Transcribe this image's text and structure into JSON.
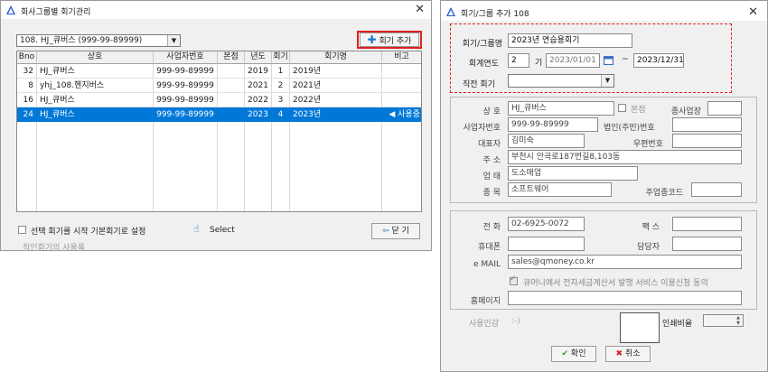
{
  "left_window": {
    "title": "회사그룹별 회기관리",
    "company_select": "108. HJ_큐버스 (999-99-89999)",
    "add_button": "회기 추가",
    "columns": [
      "Bno",
      "상호",
      "사업자번호",
      "본점",
      "년도",
      "회기",
      "회기명",
      "비고"
    ],
    "rows": [
      {
        "bno": "32",
        "name": "HJ_큐버스",
        "bizno": "999-99-89999",
        "hq": "",
        "year": "2019",
        "term": "1",
        "term_name": "2019년",
        "note": ""
      },
      {
        "bno": "8",
        "name": "yhj_108.헨지버스",
        "bizno": "999-99-89999",
        "hq": "",
        "year": "2021",
        "term": "2",
        "term_name": "2021년",
        "note": ""
      },
      {
        "bno": "16",
        "name": "HJ_큐버스",
        "bizno": "999-99-89999",
        "hq": "",
        "year": "2022",
        "term": "3",
        "term_name": "2022년",
        "note": ""
      },
      {
        "bno": "24",
        "name": "HJ_큐버스",
        "bizno": "999-99-89999",
        "hq": "",
        "year": "2023",
        "term": "4",
        "term_name": "2023년",
        "note": "◀ 사용중"
      }
    ],
    "default_checkbox_label": "선택 회기를 시작 기본회기로 설정",
    "select_label": "Select",
    "close_button": "닫 기",
    "footer_faint": "직인회기의 사용록"
  },
  "right_window": {
    "title": "회기/그룹 추가 108",
    "term_group_label": "회기/그룹명",
    "term_group_value": "2023년 연습용회기",
    "fiscal_year_label": "회계연도",
    "fiscal_term_value": "2",
    "fiscal_term_unit": "기",
    "date_from": "2023/01/01",
    "date_sep": "~",
    "date_to": "2023/12/31",
    "prev_term_label": "직전 회기",
    "prev_term_value": "",
    "company_label": "상 호",
    "company_value": "HJ_큐버스",
    "hq_label": "본점",
    "branch_label": "종사업장",
    "bizno_label": "사업자번호",
    "bizno_value": "999-99-89999",
    "corpno_label": "법인(주민)번호",
    "ceo_label": "대표자",
    "ceo_value": "김미숙",
    "zip_label": "우편번호",
    "address_label": "주 소",
    "address_value": "부천시 안곡로187번길8,103동",
    "biz_type_label": "업 태",
    "biz_type_value": "도소매업",
    "biz_item_label": "종 목",
    "biz_item_value": "소프트웨어",
    "branch_code_label": "주업종코드",
    "phone_label": "전 화",
    "phone_value": "02-6925-0072",
    "fax_label": "팩 스",
    "mobile_label": "휴대폰",
    "manager_label": "담당자",
    "email_label": "e MAIL",
    "email_value": "sales@qmoney.co.kr",
    "einvoice_label": "큐머니에서 전자세금계산서 발행 서비스 이용신청 동의",
    "homepage_label": "홈페이지",
    "seal_label": "사용인감",
    "seal_hint": ":-)",
    "print_ratio_label": "인쇄비율",
    "ok_button": "확인",
    "cancel_button": "취소"
  },
  "colors": {
    "selection": "#0078d7",
    "highlight_border": "#e02020",
    "plus": "#1e78d2"
  }
}
